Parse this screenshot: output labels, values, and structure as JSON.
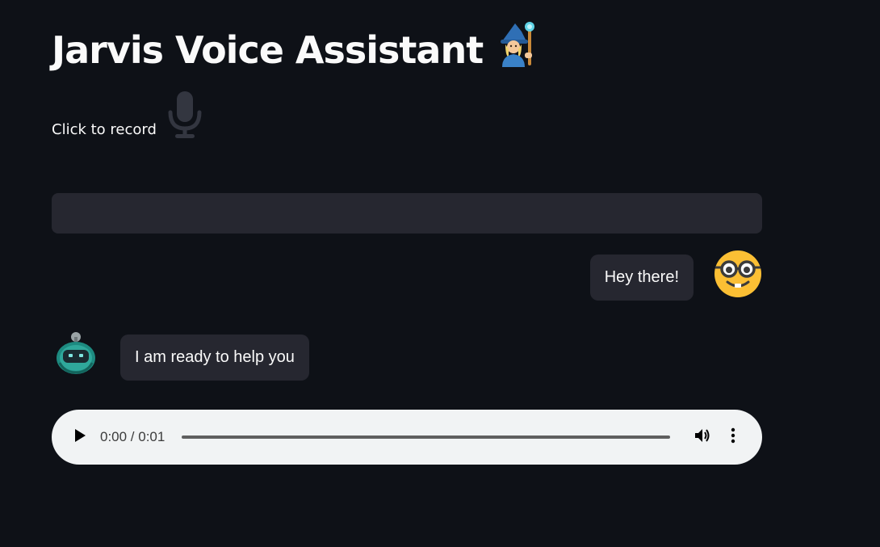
{
  "header": {
    "title": "Jarvis Voice Assistant",
    "title_icon": "mage-emoji-icon"
  },
  "recorder": {
    "label": "Click to record",
    "icon": "microphone-icon"
  },
  "transcript": {
    "value": ""
  },
  "chat": {
    "messages": [
      {
        "role": "user",
        "text": "Hey there!",
        "avatar": "nerd-face-avatar-icon"
      },
      {
        "role": "assistant",
        "text": "I am ready to help you",
        "avatar": "robot-avatar-icon"
      }
    ]
  },
  "audio_player": {
    "time": "0:00 / 0:01",
    "progress": 0,
    "play_icon": "play-icon",
    "volume_icon": "volume-icon",
    "menu_icon": "more-vertical-icon"
  },
  "colors": {
    "background": "#0e1117",
    "bubble": "#262730",
    "text": "#fafafa",
    "player_background": "#f1f3f4",
    "avatar_face": "#fbbf34",
    "robot_teal": "#1d8a80"
  }
}
